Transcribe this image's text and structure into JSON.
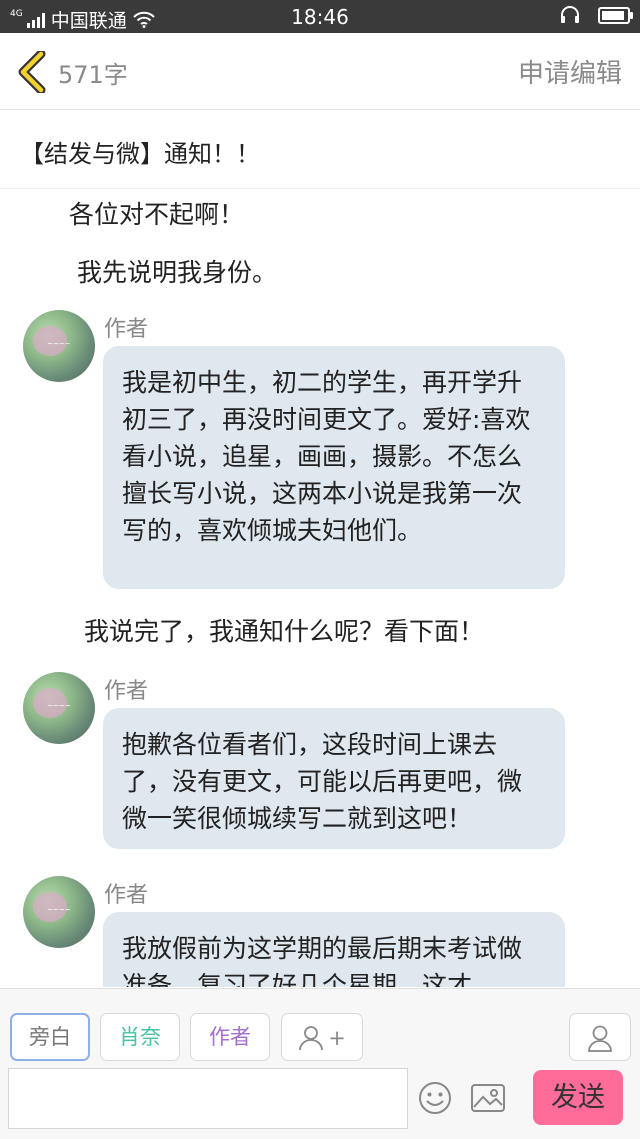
{
  "status_bar": {
    "network": "4G",
    "carrier": "中国联通",
    "time": "18:46"
  },
  "nav": {
    "word_count": "571字",
    "request_edit": "申请编辑"
  },
  "title": "【结发与微】通知！！",
  "content": {
    "narration_1": "各位对不起啊！",
    "narration_2": "我先说明我身份。",
    "msg_1": {
      "role": "作者",
      "text": "我是初中生，初二的学生，再开学升初三了，再没时间更文了。爱好:喜欢看小说，追星，画画，摄影。不怎么擅长写小说，这两本小说是我第一次写的，喜欢倾城夫妇他们。"
    },
    "narration_3": "我说完了，我通知什么呢？看下面！",
    "msg_2": {
      "role": "作者",
      "text": "抱歉各位看者们，这段时间上课去了，没有更文，可能以后再更吧，微微一笑很倾城续写二就到这吧！"
    },
    "msg_3": {
      "role": "作者",
      "text": "我放假前为这学期的最后期末考试做准备，复习了好几个星期，这才"
    }
  },
  "bottom_bar": {
    "roles": {
      "narration": "旁白",
      "yuna": "肖奈",
      "author": "作者",
      "add": "+"
    },
    "send": "发送"
  },
  "colors": {
    "bubble": "#dfe7ef",
    "send_button": "#ff6c9a",
    "role_yuna": "#45c2a5",
    "role_author": "#a46fcf",
    "selected_border": "#8fb0e6"
  },
  "icons": [
    "back-chevron-icon",
    "wifi-icon",
    "signal-icon",
    "headphones-icon",
    "battery-icon",
    "user-add-icon",
    "user-icon",
    "emoji-icon",
    "image-icon"
  ]
}
